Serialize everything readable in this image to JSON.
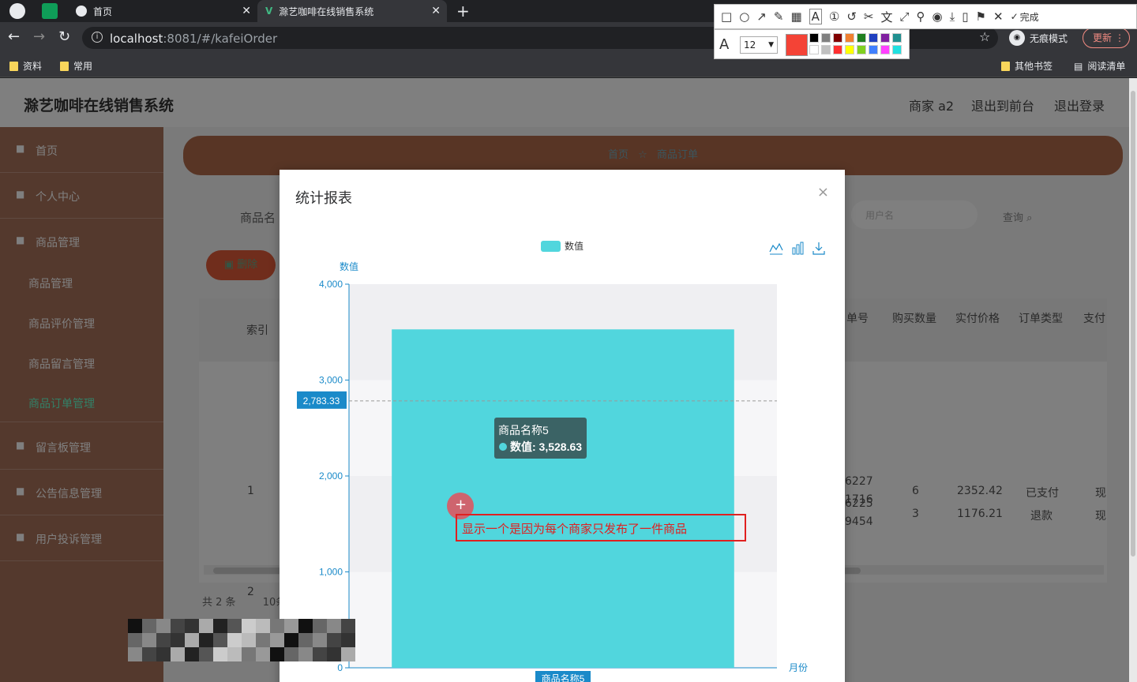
{
  "browser": {
    "tabs": [
      {
        "title": "首页"
      },
      {
        "title": "滁艺咖啡在线销售系统"
      }
    ],
    "url_host": "localhost",
    "url_rest": ":8081/#/kafeiOrder",
    "incognito_label": "无痕模式",
    "update_label": "更新",
    "bookmarks": [
      "资料",
      "常用"
    ],
    "bookmarks_right": [
      "其他书签",
      "阅读清单"
    ]
  },
  "snap_tool": {
    "done_label": "完成",
    "font_size": "12",
    "current_color": "#f44336",
    "palette": [
      "#000000",
      "#808080",
      "#800000",
      "#f08030",
      "#208020",
      "#2040c0",
      "#8020a0",
      "#209090",
      "#ffffff",
      "#c0c0c0",
      "#ff3030",
      "#ffff00",
      "#80d020",
      "#4080ff",
      "#ff40ff",
      "#20e0e0"
    ]
  },
  "app": {
    "system_title": "滁艺咖啡在线销售系统",
    "topnav": [
      "商家 a2",
      "退出到前台",
      "退出登录"
    ],
    "sidebar": [
      "首页",
      "个人中心",
      "商品管理",
      "商品管理",
      "商品评价管理",
      "商品留言管理",
      "商品订单管理",
      "留言板管理",
      "公告信息管理",
      "用户投诉管理"
    ],
    "breadcrumb": {
      "home": "首页",
      "current": "商品订单"
    },
    "search_label": "商品名",
    "search_placeholder": "用户名",
    "query_button": "查询",
    "delete_button": "删除",
    "table": {
      "headers": [
        "索引",
        "单号",
        "购买数量",
        "实付价格",
        "订单类型",
        "支付"
      ],
      "rows": [
        {
          "index": "1",
          "order_no_1": "6227",
          "order_no_2": "1716",
          "qty": "6",
          "price": "2352.42",
          "type": "已支付",
          "pay": "现"
        },
        {
          "index": "2",
          "order_no_1": "6225",
          "order_no_2": "9454",
          "qty": "3",
          "price": "1176.21",
          "type": "退款",
          "pay": "现"
        }
      ]
    },
    "pager": {
      "total": "共 2 条",
      "page_size": "10条"
    }
  },
  "modal": {
    "title": "统计报表",
    "close": "×"
  },
  "chart_data": {
    "type": "bar",
    "legend": [
      "数值"
    ],
    "categories": [
      "商品名称5"
    ],
    "series": [
      {
        "name": "数值",
        "values": [
          3528.63
        ]
      }
    ],
    "ylabel": "数值",
    "xlabel": "月份",
    "ylim": [
      0,
      4000
    ],
    "yticks": [
      "0",
      "1,000",
      "2,000",
      "3,000",
      "4,000"
    ],
    "average_line": 2783.33,
    "average_label": "2,783.33",
    "tooltip": {
      "title": "商品名称5",
      "text": "数值: 3,528.63"
    },
    "bar_color": "#51d6dd",
    "axis_color": "#1a8ac9",
    "legend_position": "top-center",
    "toolbox": [
      "line-chart-icon",
      "bar-chart-icon",
      "download-icon"
    ]
  },
  "annotation": {
    "text": "显示一个是因为每个商家只发布了一件商品",
    "color": "#e02020"
  }
}
